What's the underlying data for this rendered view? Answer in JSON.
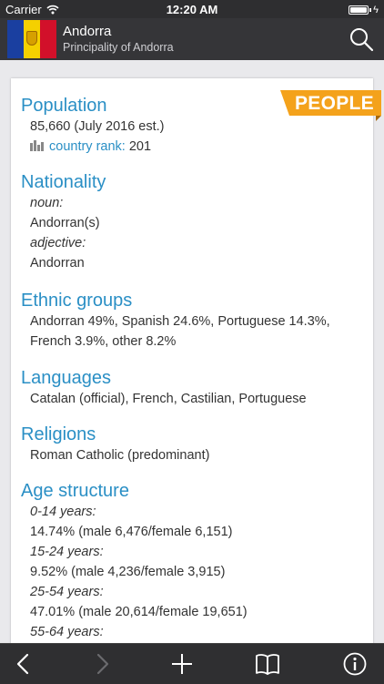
{
  "status": {
    "carrier": "Carrier",
    "time": "12:20 AM"
  },
  "nav": {
    "title": "Andorra",
    "subtitle": "Principality of Andorra",
    "flag_colors": [
      "#1a3fa0",
      "#f4d000",
      "#d2102a"
    ]
  },
  "ribbon": {
    "label": "PEOPLE",
    "color": "#f4a21b"
  },
  "sections": {
    "population": {
      "heading": "Population",
      "value": "85,660 (July 2016 est.)",
      "rank_label": "country rank:",
      "rank_value": "201"
    },
    "nationality": {
      "heading": "Nationality",
      "noun_label": "noun:",
      "noun": "Andorran(s)",
      "adjective_label": "adjective:",
      "adjective": "Andorran"
    },
    "ethnic": {
      "heading": "Ethnic groups",
      "line1": "Andorran 49%, Spanish 24.6%, Portuguese 14.3%,",
      "line2": "French 3.9%, other 8.2%"
    },
    "languages": {
      "heading": "Languages",
      "value": "Catalan (official), French, Castilian, Portuguese"
    },
    "religions": {
      "heading": "Religions",
      "value": "Roman Catholic (predominant)"
    },
    "age": {
      "heading": "Age structure",
      "groups": [
        {
          "label": "0-14 years:",
          "value": "14.74% (male 6,476/female 6,151)"
        },
        {
          "label": "15-24 years:",
          "value": "9.52% (male 4,236/female 3,915)"
        },
        {
          "label": "25-54 years:",
          "value": "47.01% (male 20,614/female 19,651)"
        },
        {
          "label": "55-64 years:",
          "value": ""
        }
      ]
    }
  },
  "icons": {
    "search": "search-icon",
    "back": "chevron-left-icon",
    "forward": "chevron-right-icon",
    "add": "plus-icon",
    "bookmarks": "book-icon",
    "info": "info-icon",
    "rank": "bar-chart-icon"
  },
  "colors": {
    "accent": "#2a8fc5",
    "nav_bg": "#353538",
    "toolbar_bg": "#2f2f31"
  }
}
